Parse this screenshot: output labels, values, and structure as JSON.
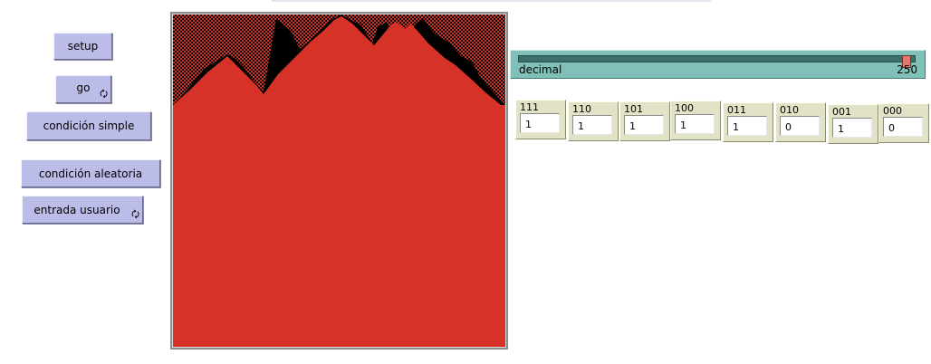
{
  "buttons": {
    "setup": "setup",
    "go": "go",
    "condicion_simple": "condición simple",
    "condicion_aleatoria": "condición aleatoria",
    "entrada_usuario": "entrada usuario"
  },
  "icons": {
    "forever": "forever-icon",
    "forever_glyph": "🗘"
  },
  "slider": {
    "label": "decimal",
    "value": "250",
    "min": 0,
    "max": 255,
    "level": 250
  },
  "rules": [
    {
      "label": "111",
      "value": "1"
    },
    {
      "label": "110",
      "value": "1"
    },
    {
      "label": "101",
      "value": "1"
    },
    {
      "label": "100",
      "value": "1"
    },
    {
      "label": "011",
      "value": "1"
    },
    {
      "label": "010",
      "value": "0"
    },
    {
      "label": "001",
      "value": "1"
    },
    {
      "label": "000",
      "value": "0"
    }
  ],
  "colors": {
    "cell_on": "#d63228",
    "cell_off": "#000000",
    "button_bg": "#bcbce8",
    "slider_bg": "#80c0b8",
    "switch_bg": "#e2e2c6"
  }
}
